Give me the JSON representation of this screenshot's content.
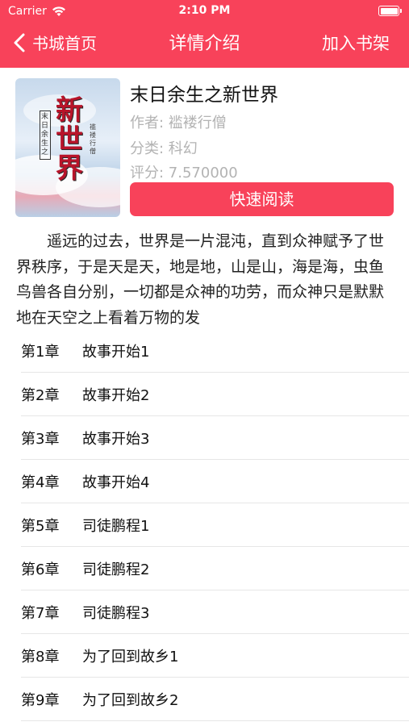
{
  "status_bar": {
    "carrier": "Carrier",
    "time": "2:10 PM"
  },
  "nav": {
    "back_label": "书城首页",
    "title": "详情介绍",
    "right_label": "加入书架"
  },
  "book": {
    "title": "末日余生之新世界",
    "author": "作者: 褴褛行僧",
    "category": "分类: 科幻",
    "score": "评分: 7.570000",
    "read_button": "快速阅读",
    "cover": {
      "title": "新世界",
      "subtitle": "末日余生之",
      "author": "褴褛行僧"
    },
    "description": "遥远的过去，世界是一片混沌，直到众神赋予了世界秩序，于是天是天，地是地，山是山，海是海，虫鱼鸟兽各自分别，一切都是众神的功劳，而众神只是默默地在天空之上看着万物的发"
  },
  "chapters": [
    {
      "num": "第1章",
      "title": "故事开始1"
    },
    {
      "num": "第2章",
      "title": "故事开始2"
    },
    {
      "num": "第3章",
      "title": "故事开始3"
    },
    {
      "num": "第4章",
      "title": "故事开始4"
    },
    {
      "num": "第5章",
      "title": "司徒鹏程1"
    },
    {
      "num": "第6章",
      "title": "司徒鹏程2"
    },
    {
      "num": "第7章",
      "title": "司徒鹏程3"
    },
    {
      "num": "第8章",
      "title": "为了回到故乡1"
    },
    {
      "num": "第9章",
      "title": "为了回到故乡2"
    }
  ],
  "colors": {
    "accent": "#f8425a",
    "meta_text": "#b3b3b3",
    "divider": "#e6e6e6"
  }
}
